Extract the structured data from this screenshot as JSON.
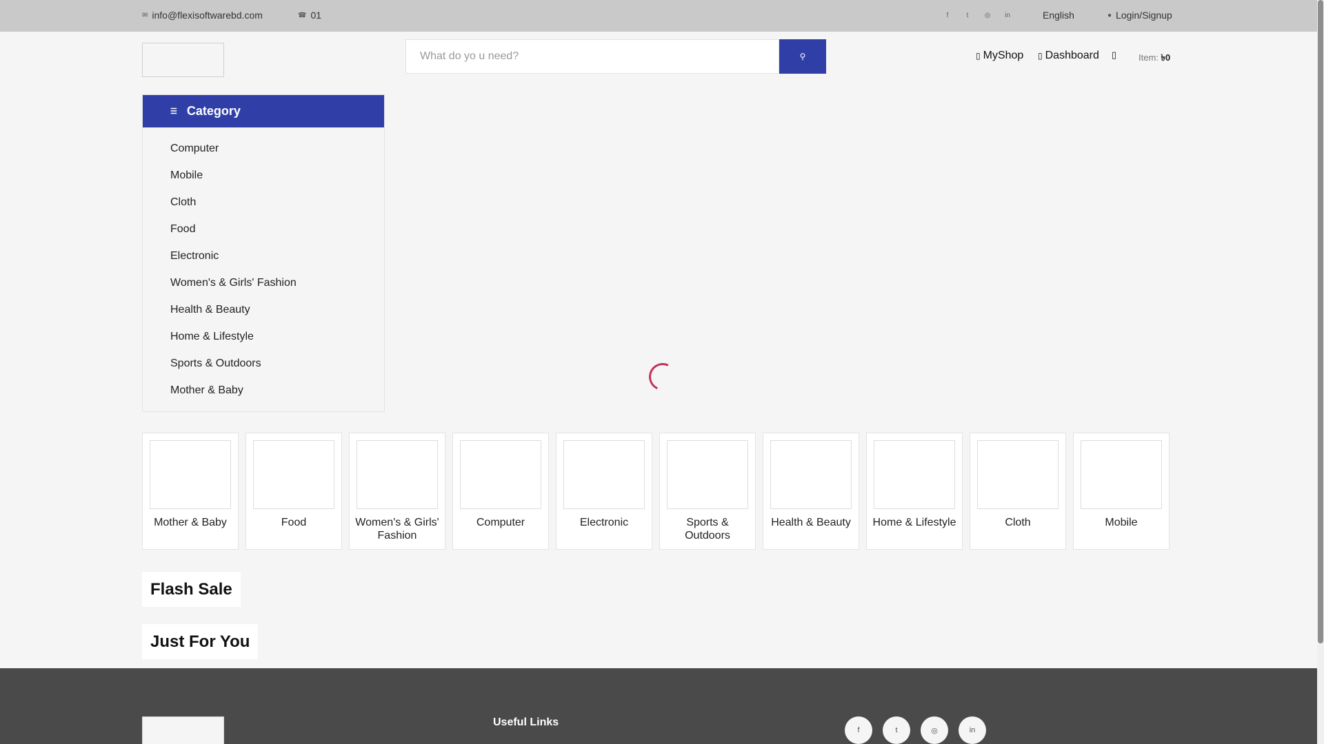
{
  "topbar": {
    "email": "info@flexisoftwarebd.com",
    "phone": "01",
    "language": "English",
    "login": "Login/Signup",
    "social_icons": [
      "facebook-icon",
      "twitter-icon",
      "instagram-icon",
      "linkedin-icon"
    ]
  },
  "header": {
    "search_placeholder": "What do yo u need?",
    "search_button_icon": "search-icon",
    "myshop": "MyShop",
    "dashboard": "Dashboard",
    "cart_label": "Item:",
    "cart_value": "৳0"
  },
  "sidebar": {
    "title": "Category",
    "items": [
      {
        "label": "Computer"
      },
      {
        "label": "Mobile"
      },
      {
        "label": "Cloth"
      },
      {
        "label": "Food"
      },
      {
        "label": "Electronic"
      },
      {
        "label": "Women's & Girls' Fashion"
      },
      {
        "label": "Health & Beauty"
      },
      {
        "label": "Home & Lifestyle"
      },
      {
        "label": "Sports & Outdoors"
      },
      {
        "label": "Mother & Baby"
      }
    ]
  },
  "categories": [
    {
      "label": "Mother & Baby"
    },
    {
      "label": "Food"
    },
    {
      "label": "Women's & Girls' Fashion"
    },
    {
      "label": "Computer"
    },
    {
      "label": "Electronic"
    },
    {
      "label": "Sports & Outdoors"
    },
    {
      "label": "Health & Beauty"
    },
    {
      "label": "Home & Lifestyle"
    },
    {
      "label": "Cloth"
    },
    {
      "label": "Mobile"
    }
  ],
  "sections": {
    "flash_sale": "Flash Sale",
    "just_for_you": "Just For You"
  },
  "footer": {
    "useful_links": "Useful Links",
    "social_icons": [
      "facebook-icon",
      "twitter-icon",
      "instagram-icon",
      "linkedin-icon"
    ]
  },
  "colors": {
    "brand_blue": "#2f3fa7",
    "spinner": "#c4305a",
    "topbar": "#c9c9c9",
    "footer": "#4a4a4a"
  }
}
